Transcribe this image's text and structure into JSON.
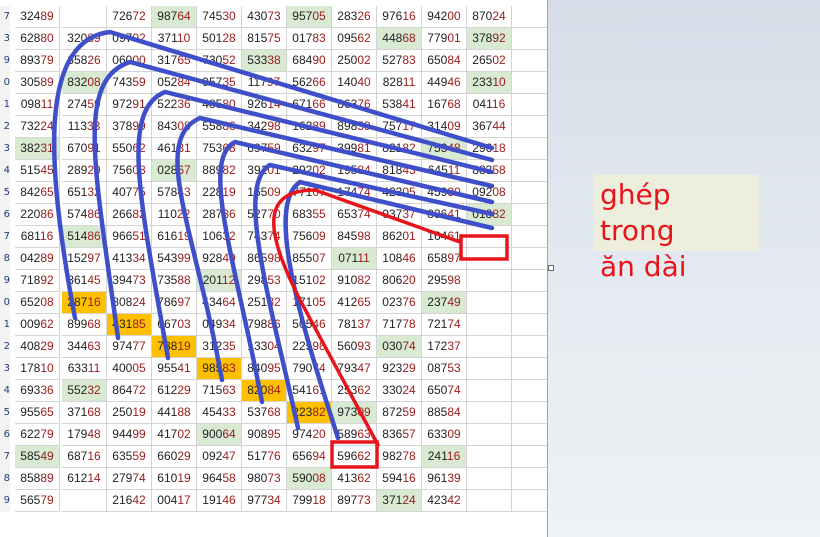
{
  "sheet": {
    "row_labels": [
      "7",
      "3",
      "9",
      "0",
      "1",
      "2",
      "3",
      "4",
      "5",
      "6",
      "7",
      "8",
      "9",
      "0",
      "1",
      "2",
      "3",
      "4",
      "5",
      "6",
      "7",
      "8",
      "9"
    ],
    "rows": [
      [
        "32489",
        "",
        "72672",
        "98764",
        "74530",
        "43073",
        "95705",
        "28326",
        "97616",
        "94200",
        "87024",
        ""
      ],
      [
        "62880",
        "32089",
        "09702",
        "37110",
        "50128",
        "81575",
        "01783",
        "09562",
        "44868",
        "77901",
        "37892",
        ""
      ],
      [
        "89379",
        "65826",
        "06000",
        "31765",
        "73052",
        "53338",
        "68490",
        "25002",
        "52783",
        "65084",
        "26502",
        ""
      ],
      [
        "30589",
        "83208",
        "74359",
        "05284",
        "95735",
        "11797",
        "56266",
        "14040",
        "82811",
        "44946",
        "23310",
        ""
      ],
      [
        "09811",
        "27459",
        "97291",
        "52236",
        "48580",
        "92614",
        "67166",
        "86376",
        "53841",
        "16768",
        "04116",
        ""
      ],
      [
        "73224",
        "11333",
        "37899",
        "84308",
        "55886",
        "34298",
        "16289",
        "89859",
        "75717",
        "31409",
        "36744",
        ""
      ],
      [
        "38231",
        "67091",
        "55062",
        "46181",
        "75368",
        "69759",
        "63297",
        "39981",
        "82182",
        "75348",
        "29618",
        ""
      ],
      [
        "51545",
        "28929",
        "75608",
        "02867",
        "88982",
        "39101",
        "29202",
        "19584",
        "81843",
        "64511",
        "88358",
        ""
      ],
      [
        "84265",
        "65132",
        "40775",
        "57843",
        "22819",
        "16509",
        "77107",
        "17474",
        "42305",
        "45930",
        "09208",
        ""
      ],
      [
        "22086",
        "57486",
        "26682",
        "11022",
        "28736",
        "52770",
        "68355",
        "65374",
        "03737",
        "83641",
        "01882",
        ""
      ],
      [
        "68116",
        "51486",
        "96651",
        "61619",
        "10632",
        "74374",
        "75609",
        "84598",
        "86201",
        "16461",
        "",
        ""
      ],
      [
        "04289",
        "15297",
        "41334",
        "54399",
        "92849",
        "86598",
        "85507",
        "07111",
        "10846",
        "65897",
        "",
        ""
      ],
      [
        "71892",
        "86145",
        "39473",
        "73588",
        "20112",
        "29853",
        "15102",
        "91082",
        "80620",
        "29598",
        "",
        ""
      ],
      [
        "65208",
        "28716",
        "80824",
        "78697",
        "43464",
        "25132",
        "17105",
        "41265",
        "02376",
        "23749",
        "",
        ""
      ],
      [
        "00962",
        "89968",
        "43185",
        "66703",
        "04934",
        "79886",
        "50546",
        "78137",
        "71778",
        "72174",
        "",
        ""
      ],
      [
        "40829",
        "34463",
        "97477",
        "78819",
        "31235",
        "13304",
        "22598",
        "56093",
        "03074",
        "17237",
        "",
        ""
      ],
      [
        "17810",
        "63311",
        "40005",
        "95541",
        "98583",
        "84095",
        "79074",
        "79347",
        "92329",
        "08753",
        "",
        ""
      ],
      [
        "69336",
        "55232",
        "86472",
        "61229",
        "71563",
        "82084",
        "54161",
        "25362",
        "33024",
        "65074",
        "",
        ""
      ],
      [
        "95565",
        "37168",
        "25019",
        "44188",
        "45433",
        "53768",
        "22382",
        "97309",
        "87259",
        "88584",
        "",
        ""
      ],
      [
        "62279",
        "17948",
        "94499",
        "41702",
        "90064",
        "90895",
        "97420",
        "58963",
        "83657",
        "63309",
        "",
        ""
      ],
      [
        "58549",
        "68716",
        "63559",
        "66029",
        "09247",
        "51776",
        "65694",
        "59662",
        "98278",
        "24116",
        "",
        ""
      ],
      [
        "85889",
        "61214",
        "27974",
        "61019",
        "96458",
        "98073",
        "59008",
        "41362",
        "59416",
        "96139",
        "",
        ""
      ],
      [
        "56579",
        "",
        "21642",
        "00417",
        "19146",
        "97734",
        "79918",
        "89773",
        "37124",
        "42342",
        "",
        ""
      ]
    ]
  },
  "note": {
    "line1": "ghép trong",
    "line2": "ăn dài"
  },
  "colors": {
    "green_fill": "#d9ead3",
    "orange_fill": "#ffc000",
    "blue_curve": "#3f4fc9",
    "red_mark": "#e8141b"
  }
}
